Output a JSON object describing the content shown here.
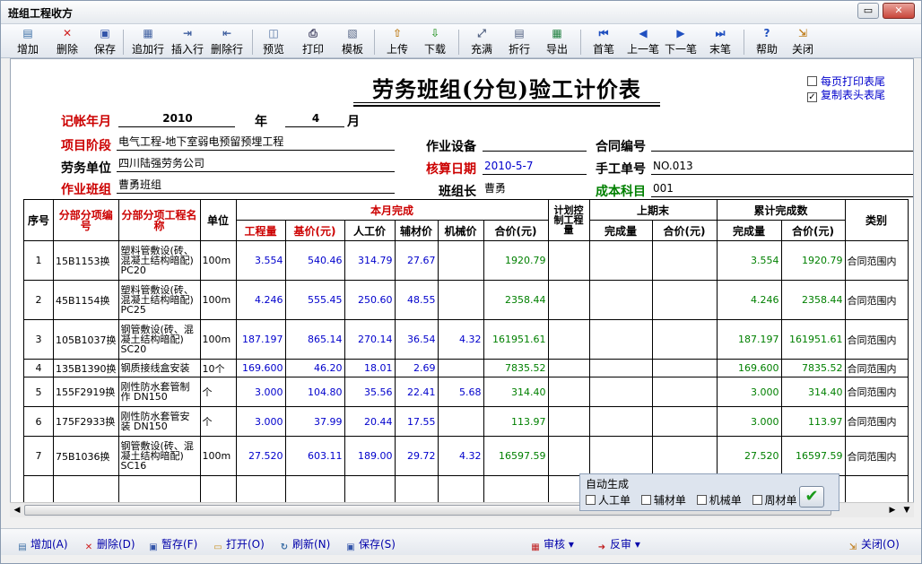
{
  "window": {
    "title": "班组工程收方",
    "restore_label": "▭",
    "close_label": "✕"
  },
  "toolbar": [
    {
      "name": "add-button",
      "icon": "add-icon",
      "glyph": "▤",
      "color": "#3a6ea5",
      "label": "增加"
    },
    {
      "name": "delete-button",
      "icon": "delete-icon",
      "glyph": "✕",
      "color": "#d02020",
      "label": "删除"
    },
    {
      "name": "save-button",
      "icon": "save-icon",
      "glyph": "▣",
      "color": "#3355aa",
      "label": "保存"
    },
    {
      "name": "append-row-button",
      "icon": "append-row-icon",
      "glyph": "▦",
      "color": "#4060a0",
      "label": "追加行"
    },
    {
      "name": "insert-row-button",
      "icon": "insert-row-icon",
      "glyph": "⇥",
      "color": "#4060a0",
      "label": "插入行"
    },
    {
      "name": "delete-row-button",
      "icon": "delete-row-icon",
      "glyph": "⇤",
      "color": "#4060a0",
      "label": "删除行"
    },
    {
      "name": "preview-button",
      "icon": "preview-icon",
      "glyph": "◫",
      "color": "#5070a0",
      "label": "预览"
    },
    {
      "name": "print-button",
      "icon": "printer-icon",
      "glyph": "⎙",
      "color": "#404060",
      "label": "打印"
    },
    {
      "name": "template-button",
      "icon": "template-icon",
      "glyph": "▧",
      "color": "#506080",
      "label": "模板"
    },
    {
      "name": "upload-button",
      "icon": "upload-icon",
      "glyph": "⇧",
      "color": "#c08020",
      "label": "上传"
    },
    {
      "name": "download-button",
      "icon": "download-icon",
      "glyph": "⇩",
      "color": "#40a040",
      "label": "下载"
    },
    {
      "name": "fill-button",
      "icon": "fill-icon",
      "glyph": "⤢",
      "color": "#506080",
      "label": "充满"
    },
    {
      "name": "fold-button",
      "icon": "fold-icon",
      "glyph": "▤",
      "color": "#506080",
      "label": "折行"
    },
    {
      "name": "export-button",
      "icon": "export-icon",
      "glyph": "▦",
      "color": "#208040",
      "label": "导出"
    },
    {
      "name": "first-button",
      "icon": "first-icon",
      "glyph": "⏮",
      "color": "#2050c0",
      "label": "首笔"
    },
    {
      "name": "prev-button",
      "icon": "prev-icon",
      "glyph": "◀",
      "color": "#2050c0",
      "label": "上一笔"
    },
    {
      "name": "next-button",
      "icon": "next-icon",
      "glyph": "▶",
      "color": "#2050c0",
      "label": "下一笔"
    },
    {
      "name": "last-button",
      "icon": "last-icon",
      "glyph": "⏭",
      "color": "#2050c0",
      "label": "末笔"
    },
    {
      "name": "help-button",
      "icon": "help-icon",
      "glyph": "?",
      "color": "#2050c0",
      "label": "帮助"
    },
    {
      "name": "close-window-button",
      "icon": "exit-icon",
      "glyph": "⇲",
      "color": "#c08020",
      "label": "关闭"
    }
  ],
  "doc": {
    "title": "劳务班组(分包)验工计价表",
    "opt_print_footer": "每页打印表尾",
    "opt_copy_header": "复制表头表尾",
    "opt_copy_header_checked": "✓"
  },
  "form": {
    "account_period_label": "记帐年月",
    "year_value": "2010",
    "year_unit": "年",
    "month_value": "4",
    "month_unit": "月",
    "project_stage_label": "项目阶段",
    "project_stage_value": "电气工程-地下室弱电预留预埋工程",
    "equipment_label": "作业设备",
    "equipment_value": "",
    "contract_no_label": "合同编号",
    "contract_no_value": "",
    "labor_unit_label": "劳务单位",
    "labor_unit_value": "四川陆强劳务公司",
    "calc_date_label": "核算日期",
    "calc_date_value": "2010-5-7",
    "manual_no_label": "手工单号",
    "manual_no_value": "NO.013",
    "team_label": "作业班组",
    "team_value": "曹勇班组",
    "leader_label": "班组长",
    "leader_value": "曹勇",
    "cost_subject_label": "成本科目",
    "cost_subject_value": "001"
  },
  "table": {
    "h_seq": "序号",
    "h_code": "分部分项编号",
    "h_name": "分部分项工程名称",
    "h_unit": "单位",
    "h_month": "本月完成",
    "h_qty": "工程量",
    "h_base": "基价(元)",
    "h_labor": "人工价",
    "h_aux": "辅材价",
    "h_mech": "机械价",
    "h_total": "合价(元)",
    "h_plan": "计划控制工程量",
    "h_prev": "上期末",
    "h_prev_qty": "完成量",
    "h_prev_total": "合价(元)",
    "h_cum": "累计完成数",
    "h_cum_qty": "完成量",
    "h_cum_total": "合价(元)",
    "h_type": "类别",
    "rows": [
      {
        "seq": "1",
        "code": "15B1153换",
        "name": "塑料管敷设(砖、混凝土结构暗配) PC20",
        "unit": "100m",
        "qty": "3.554",
        "base": "540.46",
        "labor": "314.79",
        "aux": "27.67",
        "mech": "",
        "total": "1920.79",
        "plan": "",
        "pqty": "",
        "ptotal": "",
        "cqty": "3.554",
        "ctotal": "1920.79",
        "type": "合同范围内"
      },
      {
        "seq": "2",
        "code": "45B1154换",
        "name": "塑料管敷设(砖、混凝土结构暗配) PC25",
        "unit": "100m",
        "qty": "4.246",
        "base": "555.45",
        "labor": "250.60",
        "aux": "48.55",
        "mech": "",
        "total": "2358.44",
        "plan": "",
        "pqty": "",
        "ptotal": "",
        "cqty": "4.246",
        "ctotal": "2358.44",
        "type": "合同范围内"
      },
      {
        "seq": "3",
        "code": "105B1037换",
        "name": "钢管敷设(砖、混凝土结构暗配) SC20",
        "unit": "100m",
        "qty": "187.197",
        "base": "865.14",
        "labor": "270.14",
        "aux": "36.54",
        "mech": "4.32",
        "total": "161951.61",
        "plan": "",
        "pqty": "",
        "ptotal": "",
        "cqty": "187.197",
        "ctotal": "161951.61",
        "type": "合同范围内"
      },
      {
        "seq": "4",
        "code": "135B1390换",
        "name": "钢质接线盒安装",
        "unit": "10个",
        "qty": "169.600",
        "base": "46.20",
        "labor": "18.01",
        "aux": "2.69",
        "mech": "",
        "total": "7835.52",
        "plan": "",
        "pqty": "",
        "ptotal": "",
        "cqty": "169.600",
        "ctotal": "7835.52",
        "type": "合同范围内"
      },
      {
        "seq": "5",
        "code": "155F2919换",
        "name": "刚性防水套管制作 DN150",
        "unit": "个",
        "qty": "3.000",
        "base": "104.80",
        "labor": "35.56",
        "aux": "22.41",
        "mech": "5.68",
        "total": "314.40",
        "plan": "",
        "pqty": "",
        "ptotal": "",
        "cqty": "3.000",
        "ctotal": "314.40",
        "type": "合同范围内"
      },
      {
        "seq": "6",
        "code": "175F2933换",
        "name": "刚性防水套管安装 DN150",
        "unit": "个",
        "qty": "3.000",
        "base": "37.99",
        "labor": "20.44",
        "aux": "17.55",
        "mech": "",
        "total": "113.97",
        "plan": "",
        "pqty": "",
        "ptotal": "",
        "cqty": "3.000",
        "ctotal": "113.97",
        "type": "合同范围内"
      },
      {
        "seq": "7",
        "code": "75B1036换",
        "name": "钢管敷设(砖、混凝土结构暗配) SC16",
        "unit": "100m",
        "qty": "27.520",
        "base": "603.11",
        "labor": "189.00",
        "aux": "29.72",
        "mech": "4.32",
        "total": "16597.59",
        "plan": "",
        "pqty": "",
        "ptotal": "",
        "cqty": "27.520",
        "ctotal": "16597.59",
        "type": "合同范围内"
      }
    ]
  },
  "autogen": {
    "legend": "自动生成",
    "opt_labor": "人工单",
    "opt_aux": "辅材单",
    "opt_mech": "机械单",
    "opt_turnover": "周材单",
    "ok_glyph": "✔"
  },
  "bottom": {
    "add": "增加(A)",
    "delete": "删除(D)",
    "temp_save": "暂存(F)",
    "open": "打开(O)",
    "refresh": "刷新(N)",
    "save": "保存(S)",
    "audit": "审核",
    "unaudit": "反审",
    "close": "关闭(O)"
  },
  "colors": {
    "label_red": "#cc0000",
    "label_green": "#008000",
    "value_blue": "#0000cc",
    "amount_green": "#008000"
  }
}
